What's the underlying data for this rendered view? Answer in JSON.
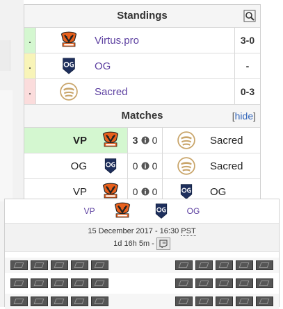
{
  "standings": {
    "title": "Standings",
    "rows": [
      {
        "status": ".",
        "status_color": "#d4f7d0",
        "team": "Virtus.pro",
        "logo": "virtus-pro-logo",
        "score": "3-0"
      },
      {
        "status": ".",
        "status_color": "#f8f4b8",
        "team": "OG",
        "logo": "og-logo",
        "score": "-"
      },
      {
        "status": ".",
        "status_color": "#fbdcdc",
        "team": "Sacred",
        "logo": "sacred-logo",
        "score": "0-3"
      }
    ]
  },
  "matches": {
    "title": "Matches",
    "hide_open": "[",
    "hide_label": "hide",
    "hide_close": "]",
    "rows": [
      {
        "left": "VP",
        "left_logo": "virtus-pro-logo",
        "left_score": "3",
        "right_score": "0",
        "right": "Sacred",
        "right_logo": "sacred-logo",
        "winner": "left"
      },
      {
        "left": "OG",
        "left_logo": "og-logo",
        "left_score": "0",
        "right_score": "0",
        "right": "Sacred",
        "right_logo": "sacred-logo",
        "winner": "none"
      },
      {
        "left": "VP",
        "left_logo": "virtus-pro-logo",
        "left_score": "0",
        "right_score": "0",
        "right": "OG",
        "right_logo": "og-logo",
        "winner": "none"
      }
    ]
  },
  "popup": {
    "team_left": "VP",
    "team_right": "OG",
    "date": "15 December 2017 - 16:30",
    "timezone": "PST",
    "countdown": "1d 16h 5m -",
    "stream_icon": "twitch-icon"
  },
  "colors": {
    "link": "#5c3fa0",
    "win_bg": "#d4f7d0",
    "vp_orange": "#e8601c",
    "og_navy": "#1e2f5c",
    "sacred_tan": "#c9a56a"
  }
}
